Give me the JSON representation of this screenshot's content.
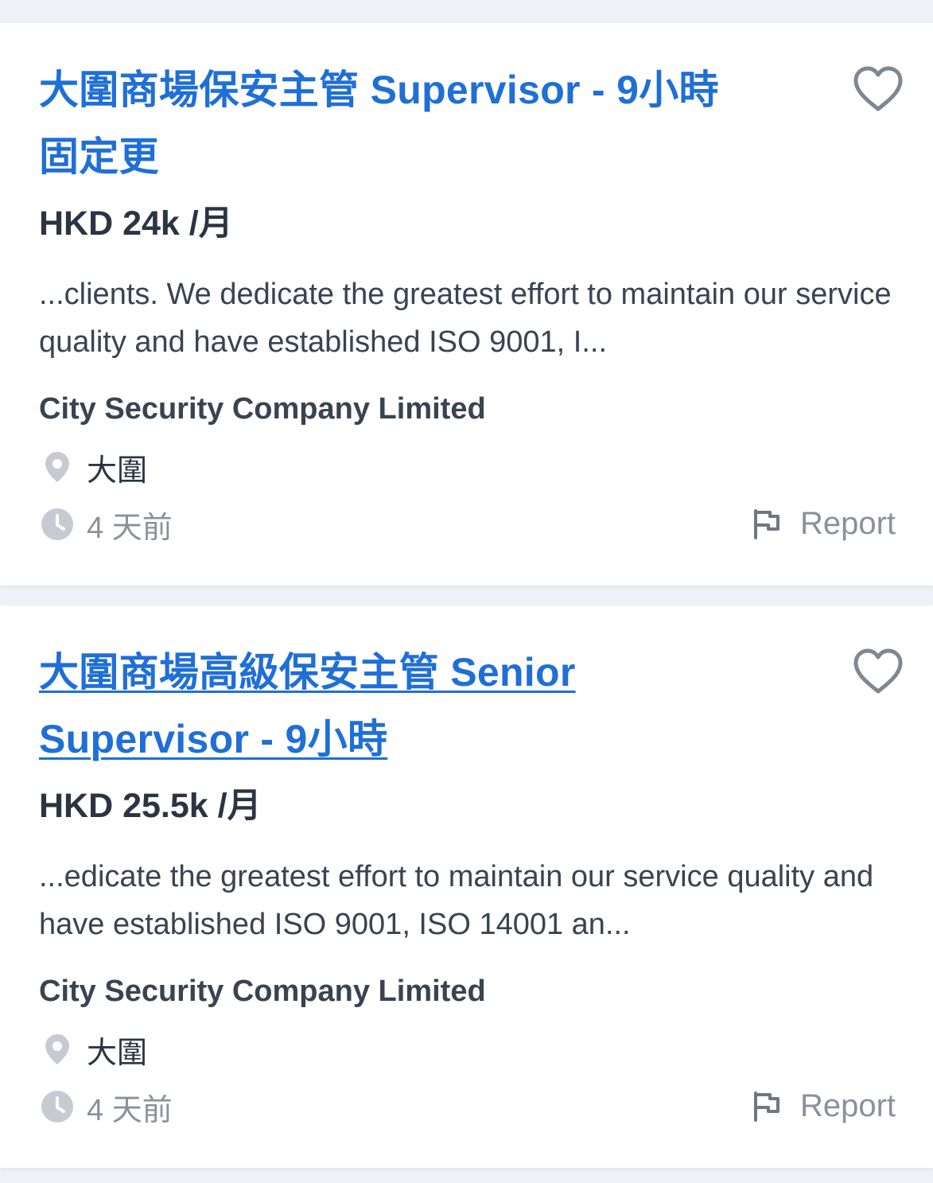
{
  "jobs": [
    {
      "title": "大圍商場保安主管 Supervisor - 9小時固定更",
      "salary": "HKD 24k /月",
      "snippet": " ...clients. We dedicate the greatest effort to maintain our service quality and have established ISO 9001, I...",
      "company": "City Security Company Limited",
      "location": "大圍",
      "posted": "4 天前",
      "report_label": "Report",
      "favorite_icon": "heart-outline-icon"
    },
    {
      "title": "大圍商場高級保安主管 Senior Supervisor - 9小時",
      "salary": "HKD 25.5k /月",
      "snippet": " ...edicate the greatest effort to maintain our service quality and have established ISO 9001, ISO 14001 an...",
      "company": "City Security Company Limited",
      "location": "大圍",
      "posted": "4 天前",
      "report_label": "Report",
      "favorite_icon": "heart-outline-icon"
    }
  ],
  "colors": {
    "title_link": "#1f6fd6",
    "text_dark": "#2b3442",
    "text_muted": "#8a919c",
    "page_background": "#eef1f5",
    "card_background": "#ffffff"
  }
}
